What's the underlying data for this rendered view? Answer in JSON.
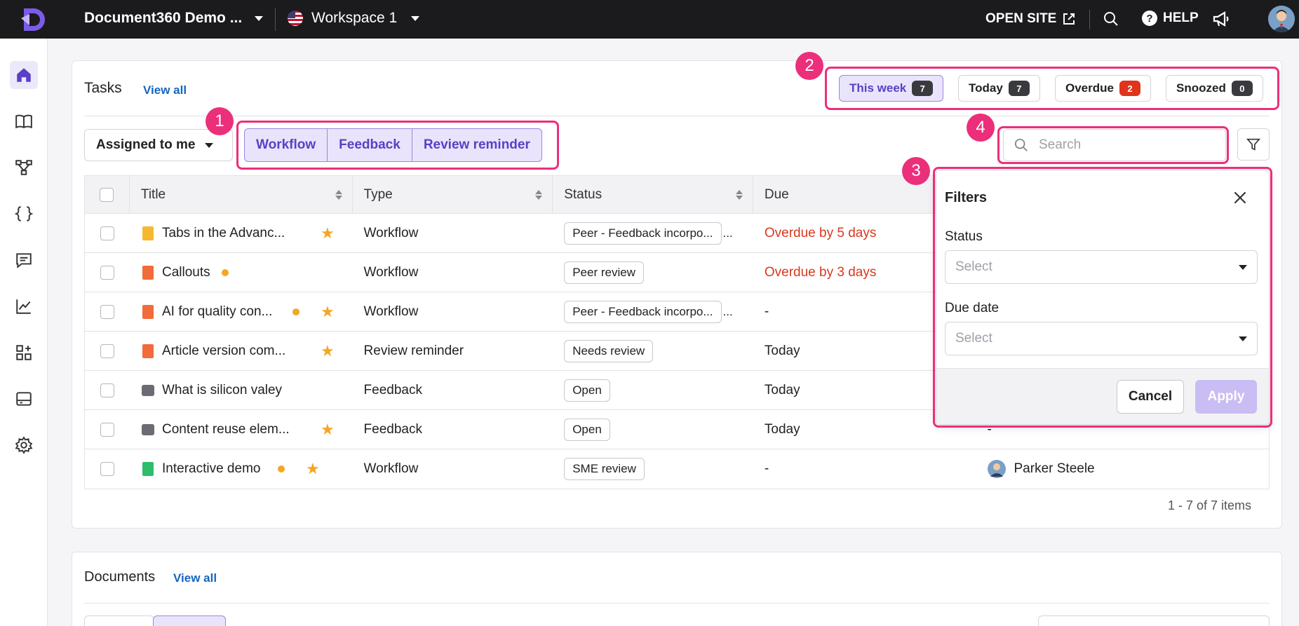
{
  "topbar": {
    "project_name": "Document360 Demo ...",
    "workspace": "Workspace 1",
    "open_site": "OPEN SITE",
    "help": "HELP",
    "help_glyph": "?"
  },
  "sidebar": {
    "icons": [
      "home-icon",
      "book-icon",
      "workflow-icon",
      "api-braces-icon",
      "comment-icon",
      "analytics-icon",
      "widgets-icon",
      "widget-panel-icon",
      "settings-icon"
    ],
    "active": "home-icon"
  },
  "tasks": {
    "title": "Tasks",
    "view_all": "View all",
    "periods": [
      {
        "label": "This week",
        "count": "7"
      },
      {
        "label": "Today",
        "count": "7"
      },
      {
        "label": "Overdue",
        "count": "2"
      },
      {
        "label": "Snoozed",
        "count": "0"
      }
    ],
    "assigned_filter": "Assigned to me",
    "types": [
      "Workflow",
      "Feedback",
      "Review reminder"
    ],
    "search_placeholder": "Search",
    "columns": [
      "Title",
      "Type",
      "Status",
      "Due",
      ""
    ],
    "rows": [
      {
        "title": "Tabs in the Advanc...",
        "type": "Workflow",
        "status": "Peer - Feedback incorpo...",
        "status_more": "...",
        "due": "Overdue by 5 days",
        "assignee": ""
      },
      {
        "title": "Callouts",
        "type": "Workflow",
        "status": "Peer review",
        "status_more": "",
        "due": "Overdue by 3 days",
        "assignee": ""
      },
      {
        "title": "AI for quality con...",
        "type": "Workflow",
        "status": "Peer - Feedback incorpo...",
        "status_more": "...",
        "due": "-",
        "assignee": ""
      },
      {
        "title": "Article version com...",
        "type": "Review reminder",
        "status": "Needs review",
        "status_more": "",
        "due": "Today",
        "assignee": ""
      },
      {
        "title": "What is silicon valey",
        "type": "Feedback",
        "status": "Open",
        "status_more": "",
        "due": "Today",
        "assignee": ""
      },
      {
        "title": "Content reuse elem...",
        "type": "Feedback",
        "status": "Open",
        "status_more": "",
        "due": "Today",
        "assignee": "-"
      },
      {
        "title": "Interactive demo",
        "type": "Workflow",
        "status": "SME review",
        "status_more": "",
        "due": "-",
        "assignee": "Parker Steele"
      }
    ],
    "pagination": "1 - 7 of 7 items"
  },
  "filters": {
    "title": "Filters",
    "status_label": "Status",
    "status_placeholder": "Select",
    "due_label": "Due date",
    "due_placeholder": "Select",
    "cancel": "Cancel",
    "apply": "Apply"
  },
  "annotations": [
    "1",
    "2",
    "3",
    "4"
  ],
  "documents": {
    "title": "Documents",
    "view_all": "View all"
  },
  "colors": {
    "accent": "#5b3fc4",
    "highlight": "#ec2f7a",
    "overdue": "#d9381e",
    "star": "#f5a623"
  }
}
